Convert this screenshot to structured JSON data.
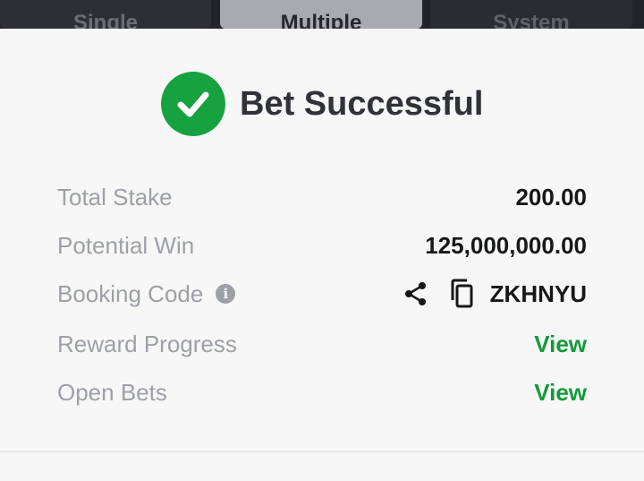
{
  "tabs": [
    {
      "label": "Single"
    },
    {
      "label": "Multiple"
    },
    {
      "label": "System"
    }
  ],
  "header": {
    "title": "Bet Successful",
    "icon": "check-circle-icon",
    "accent": "#17a23f"
  },
  "details": {
    "total_stake": {
      "label": "Total Stake",
      "value": "200.00"
    },
    "potential_win": {
      "label": "Potential Win",
      "value": "125,000,000.00"
    },
    "booking_code": {
      "label": "Booking Code",
      "info_icon": "i",
      "value": "ZKHNYU"
    },
    "reward_progress": {
      "label": "Reward Progress",
      "link": "View"
    },
    "open_bets": {
      "label": "Open Bets",
      "link": "View"
    }
  }
}
